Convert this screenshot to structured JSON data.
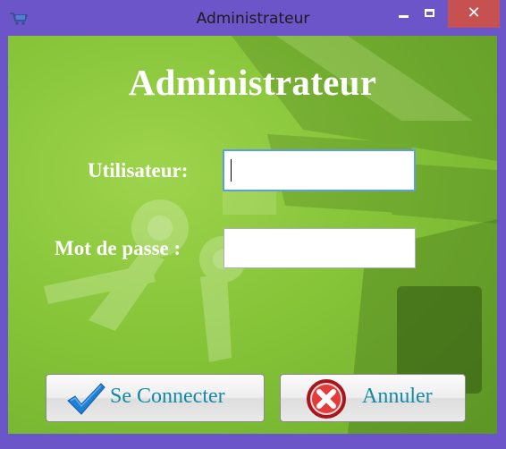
{
  "window": {
    "title": "Administrateur",
    "app_icon": "cart-icon",
    "controls": {
      "minimize_icon": "minimize-icon",
      "maximize_icon": "maximize-icon",
      "close_icon": "close-icon",
      "close_glyph": "✕"
    },
    "colors": {
      "frame": "#6b55c8",
      "close": "#c75050"
    }
  },
  "form": {
    "heading": "Administrateur",
    "username": {
      "label": "Utilisateur:",
      "value": ""
    },
    "password": {
      "label": "Mot de passe :",
      "value": ""
    },
    "background_colors": {
      "light": "#9ed44d",
      "dark": "#6fae2e"
    }
  },
  "buttons": {
    "connect": {
      "label": "Se Connecter",
      "icon": "checkmark-icon"
    },
    "cancel": {
      "label": "Annuler",
      "icon": "cancel-icon"
    },
    "label_color": "#138aa6"
  }
}
